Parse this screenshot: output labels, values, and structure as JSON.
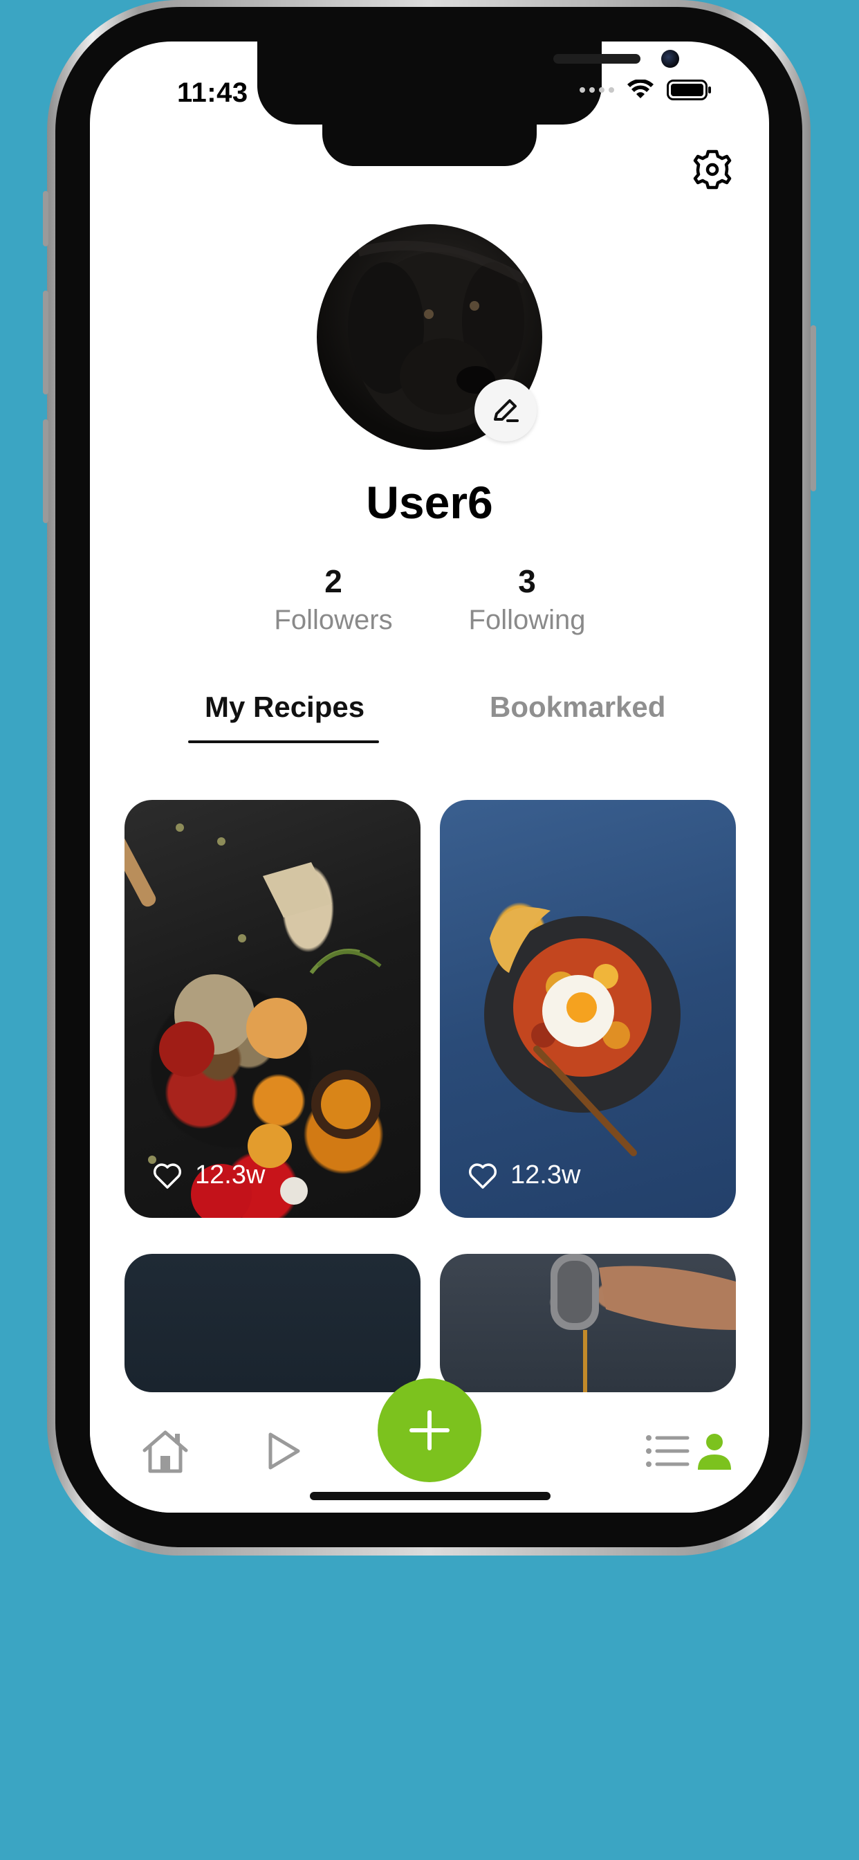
{
  "status_bar": {
    "time": "11:43"
  },
  "profile": {
    "username": "User6",
    "followers_count": "2",
    "followers_label": "Followers",
    "following_count": "3",
    "following_label": "Following"
  },
  "tabs": {
    "my_recipes": "My Recipes",
    "bookmarked": "Bookmarked",
    "active": "My Recipes"
  },
  "recipes": [
    {
      "likes": "12.3w"
    },
    {
      "likes": "12.3w"
    }
  ],
  "icons": {
    "settings": "gear-icon",
    "edit_avatar": "pencil-icon",
    "like": "heart-icon",
    "nav_home": "home-icon",
    "nav_play": "play-icon",
    "nav_add": "plus-icon",
    "nav_list": "list-icon",
    "nav_profile": "person-icon"
  },
  "colors": {
    "background": "#3ba5c3",
    "accent": "#7cc21e",
    "text_primary": "#111111",
    "text_secondary": "#8a8a8a"
  }
}
